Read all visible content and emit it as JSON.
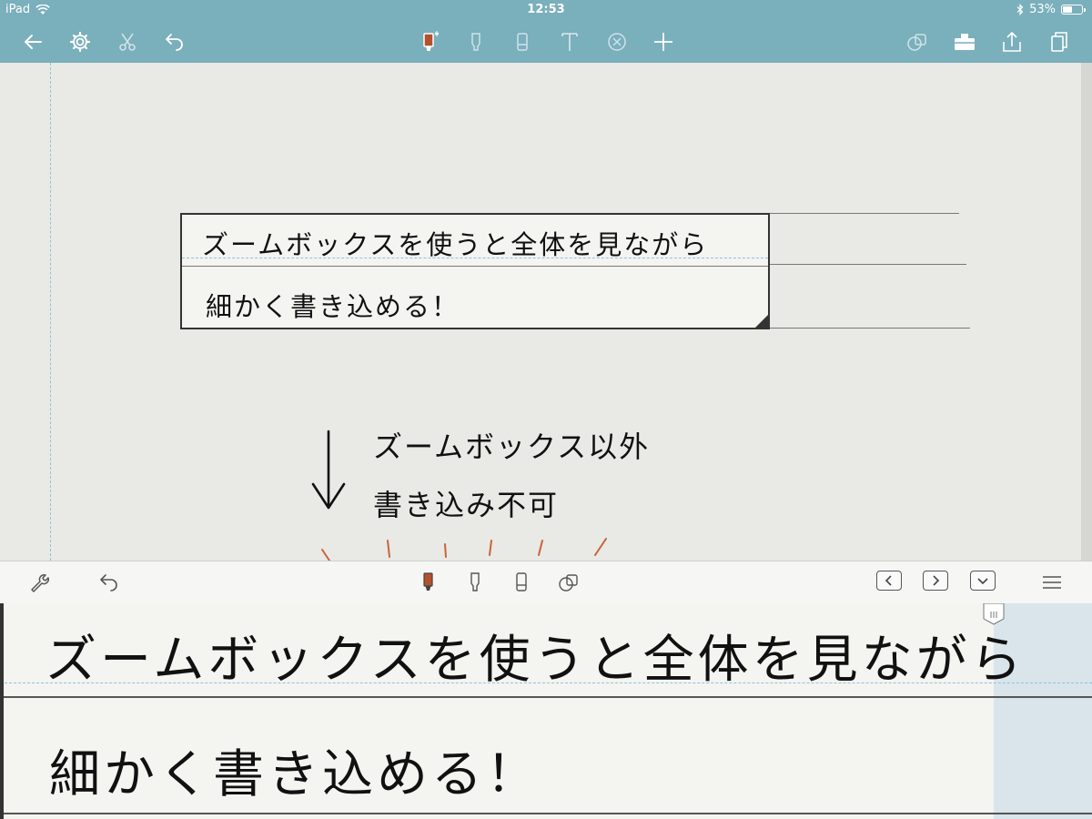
{
  "status_bar": {
    "device": "iPad",
    "time": "12:53",
    "battery": "53%",
    "battery_level": 0.53
  },
  "toolbar": {
    "left": [
      "back-arrow-icon",
      "gear-icon",
      "scissors-icon",
      "undo-icon"
    ],
    "center": [
      "pen-icon",
      "highlighter-icon",
      "eraser-icon",
      "text-icon",
      "delete-circle-icon",
      "add-icon"
    ],
    "right": [
      "shapes-icon",
      "toolbox-icon",
      "share-icon",
      "pages-icon"
    ],
    "active_pen_color": "#b4512c",
    "bar_color": "#7aafbc"
  },
  "canvas": {
    "zoombox_line1": "ズームボックスを使うと全体を見ながら",
    "zoombox_line2": "細かく書き込める！",
    "note_line1": "ズームボックス以外",
    "note_line2": "書き込み不可",
    "arrow": "↓"
  },
  "zoom_panel": {
    "toolbar_left": [
      "wrench-icon",
      "undo-icon"
    ],
    "toolbar_center": [
      "pen-icon",
      "highlighter-icon",
      "eraser-icon",
      "shapes-icon"
    ],
    "toolbar_right": [
      "prev-icon",
      "next-icon",
      "down-icon",
      "menu-icon"
    ],
    "line1": "ズームボックスを使うと全体を見ながら",
    "line2": "細かく書き込める！"
  }
}
